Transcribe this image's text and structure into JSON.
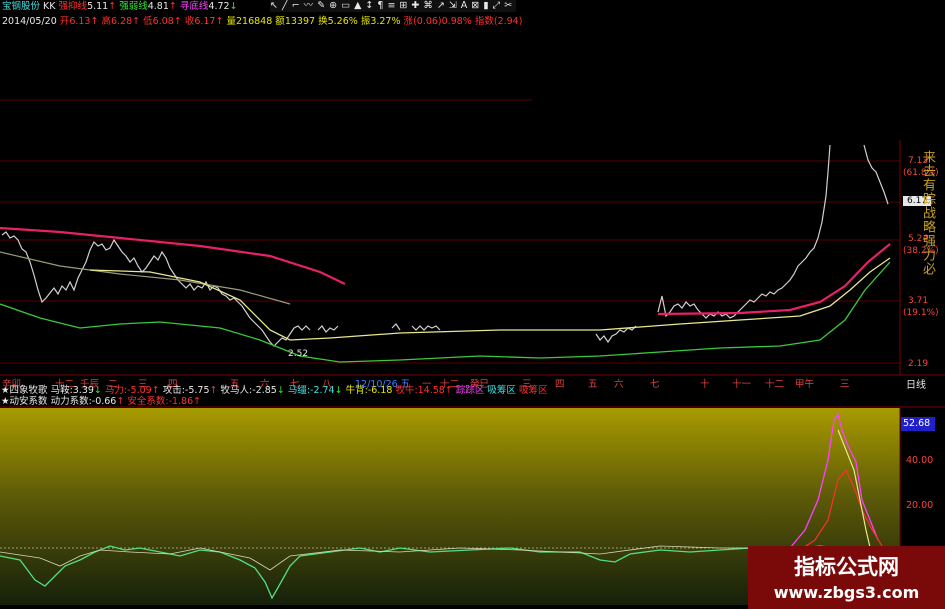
{
  "header": {
    "row1": {
      "stock_name": "宝钢股份",
      "code_tag": "KK",
      "strong_label": "强抑线",
      "strong_value": "5.11",
      "strong_arrow": "↑",
      "strong2_label": "强弱线",
      "strong2_value": "4.81",
      "strong2_arrow": "↑",
      "bottom_label": "寻底线",
      "bottom_value": "4.72",
      "bottom_arrow": "↓",
      "toolbar_glyphs": [
        "↖",
        "╱",
        "⌐",
        "〰",
        "✎",
        "⊕",
        "▭",
        "▲",
        "↕",
        "¶",
        "≡",
        "⊞",
        "✚",
        "⌘",
        "↗",
        "⇲",
        "A",
        "⊠",
        "▮",
        "⤢",
        "✂"
      ]
    },
    "row2": {
      "date": "2014/05/20",
      "open_label": "开",
      "open_value": "6.13",
      "high_label": "高",
      "high_value": "6.28",
      "low_label": "低",
      "low_value": "6.08",
      "close_label": "收",
      "close_value": "6.17",
      "vol_label": "量",
      "vol_value": "216848",
      "amt_label": "额",
      "amt_value": "13397",
      "turn_label": "换",
      "turn_value": "5.26%",
      "amp_label": "振",
      "amp_value": "3.27%",
      "chg_label": "涨",
      "chg_value": "(0.06)0.98%",
      "idx_label": "指数",
      "idx_value": "(2.94)"
    }
  },
  "price_axis": {
    "labels": [
      "7.13",
      "(61.8%)",
      "6.17",
      "5.24",
      "(38.2%)",
      "3.71",
      "(19.1%)",
      "2.19"
    ],
    "current_price_tag": "6.17",
    "low_marker": "2.52"
  },
  "vertical_side_text": "来去有踪战略强力必",
  "x_axis": {
    "ticks": [
      "辛卯",
      "十二",
      "壬辰",
      "二",
      "三",
      "四",
      "五",
      "六",
      "七",
      "八",
      "12/10/26,五",
      "一",
      "十二",
      "癸巳",
      "三",
      "四",
      "五",
      "六",
      "七",
      "十",
      "十一",
      "十二",
      "甲午",
      "三"
    ],
    "period": "日线"
  },
  "indicator_line1": {
    "name": "★四象牧歌",
    "items": [
      {
        "label": "马鞍:",
        "value": "3.39",
        "arrow": "↓"
      },
      {
        "label": "马力:",
        "value": "-5.09",
        "arrow": "↑"
      },
      {
        "label": "攻击:",
        "value": "-5.75",
        "arrow": "↑"
      },
      {
        "label": "牧马人:",
        "value": "-2.85",
        "arrow": "↓"
      },
      {
        "label": "马缰:",
        "value": "-2.74",
        "arrow": "↓"
      },
      {
        "label": "牛背:",
        "value": "-6.18",
        "arrow": ""
      },
      {
        "label": "牧牛:",
        "value": "14.58",
        "arrow": "↑"
      },
      {
        "label": "",
        "value": "踪踪区",
        "arrow": ""
      },
      {
        "label": "",
        "value": "吸筹区",
        "arrow": ""
      },
      {
        "label": "",
        "value": "吸筹区",
        "arrow": ""
      }
    ]
  },
  "indicator_line2": {
    "name": "★动安系数",
    "label1": "动力系数:",
    "value1": "-0.66",
    "arrow1": "↑",
    "label2": "安全系数:",
    "value2": "-1.86",
    "arrow2": "↑"
  },
  "sub_axis": {
    "labels": [
      "52.68",
      "40.00",
      "20.00"
    ]
  },
  "watermark": {
    "title": "指标公式网",
    "url": "www.zbgs3.com"
  },
  "colors": {
    "background": "#000000",
    "grid_red": "#5a0000",
    "ma_magenta": "#e8206a",
    "ma_yellow": "#e8e890",
    "ma_green": "#3cc83c",
    "candle": "#d0d0d0",
    "panel_top": "#b5a800",
    "panel_bottom": "#1e2a0a"
  }
}
